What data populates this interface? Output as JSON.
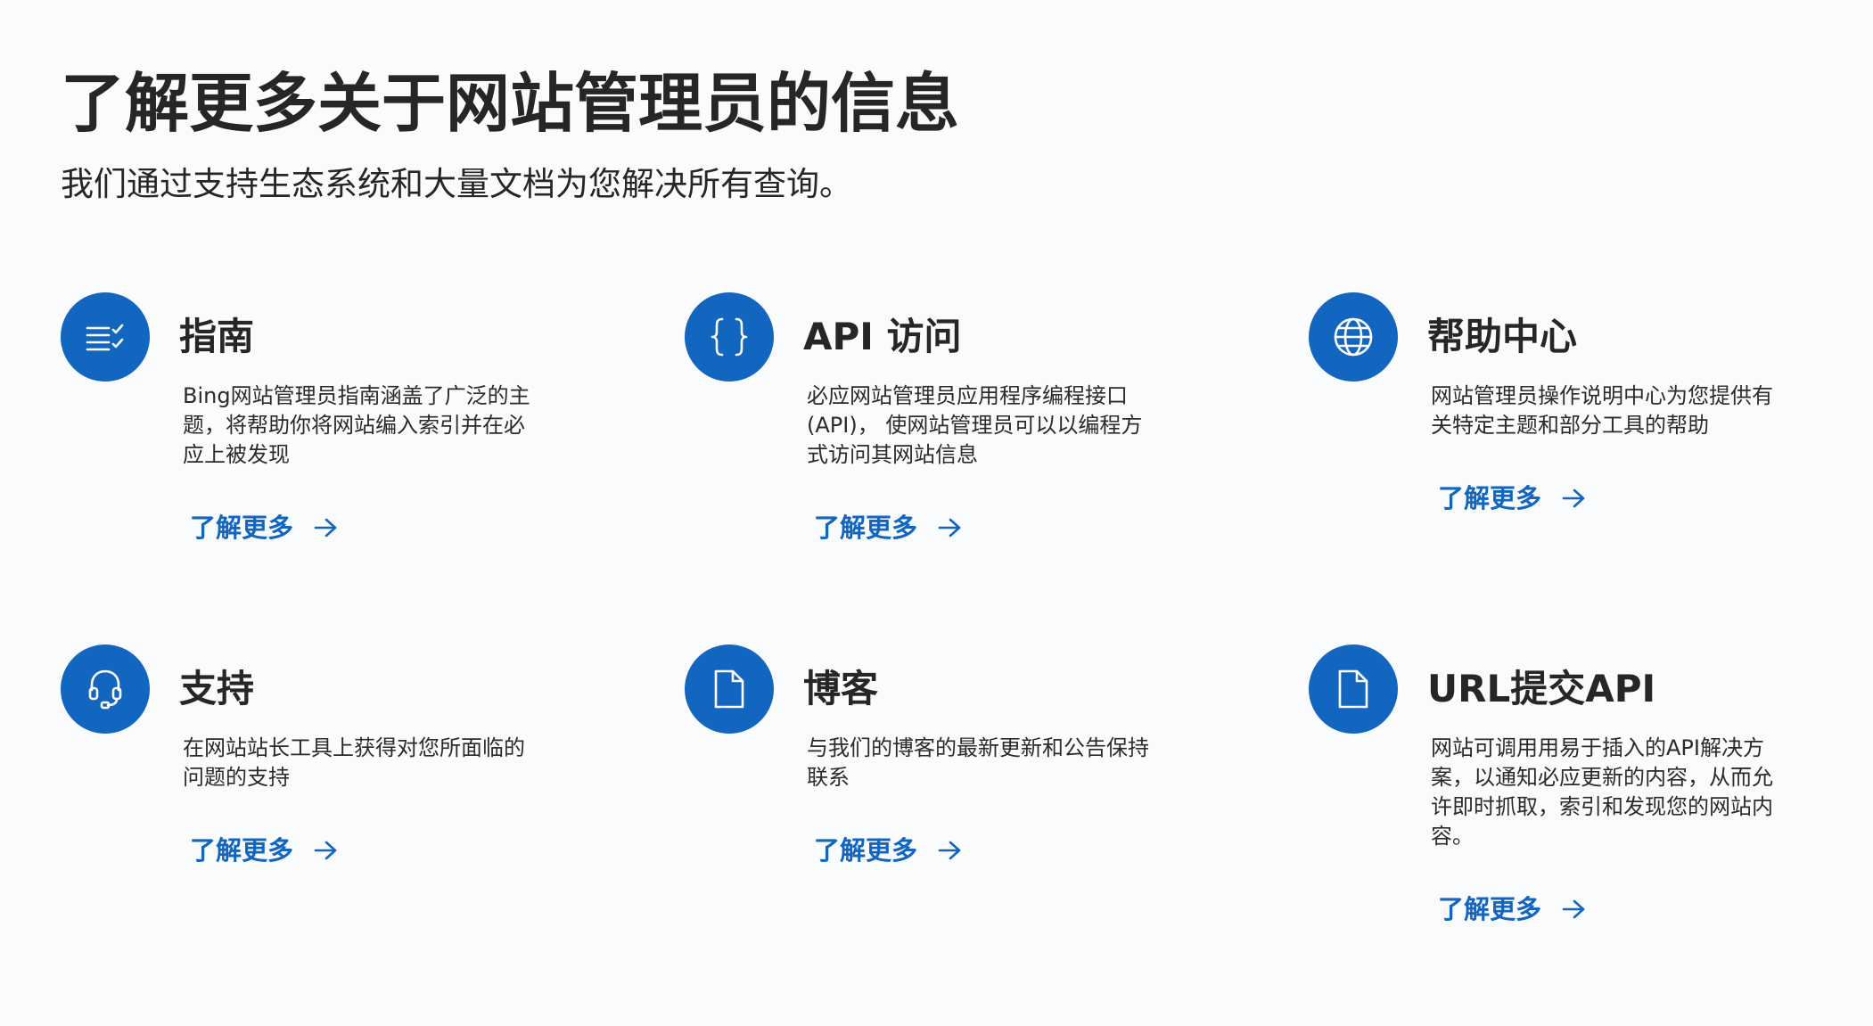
{
  "header": {
    "title": "了解更多关于网站管理员的信息",
    "subtitle": "我们通过支持生态系统和大量文档为您解决所有查询。"
  },
  "colors": {
    "accent": "#1366c0",
    "text": "#262626",
    "background": "#f9fbfc"
  },
  "cards": [
    {
      "icon": "list-check-icon",
      "title": "指南",
      "description": "Bing网站管理员指南涵盖了广泛的主题，将帮助你将网站编入索引并在必应上被发现",
      "link_label": "了解更多"
    },
    {
      "icon": "curly-braces-icon",
      "title": "API 访问",
      "description": "必应网站管理员应用程序编程接口 (API)， 使网站管理员可以以编程方式访问其网站信息",
      "link_label": "了解更多"
    },
    {
      "icon": "globe-icon",
      "title": "帮助中心",
      "description": "网站管理员操作说明中心为您提供有关特定主题和部分工具的帮助",
      "link_label": "了解更多"
    },
    {
      "icon": "headset-icon",
      "title": "支持",
      "description": "在网站站长工具上获得对您所面临的问题的支持",
      "link_label": "了解更多"
    },
    {
      "icon": "document-icon",
      "title": "博客",
      "description": "与我们的博客的最新更新和公告保持联系",
      "link_label": "了解更多"
    },
    {
      "icon": "document-icon",
      "title": "URL提交API",
      "description": "网站可调用用易于插入的API解决方案，以通知必应更新的内容，从而允许即时抓取，索引和发现您的网站内容。",
      "link_label": "了解更多"
    }
  ]
}
